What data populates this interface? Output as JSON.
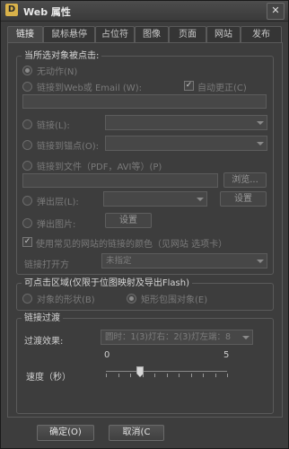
{
  "window": {
    "title": "Web 属性",
    "app_icon": "D",
    "close_glyph": "✕"
  },
  "tabs": [
    {
      "label": "链接",
      "active": true
    },
    {
      "label": "鼠标悬停"
    },
    {
      "label": "占位符"
    },
    {
      "label": "图像"
    },
    {
      "label": "页面"
    },
    {
      "label": "网站"
    },
    {
      "label": "发布"
    }
  ],
  "click_group": {
    "legend": "当所选对象被点击:",
    "no_action": "无动作(N)",
    "link_web_email": "链接到Web或 Email (W):",
    "auto_update": "自动更正(C)",
    "auto_update_checked": true,
    "link": "链接(L):",
    "link_anchor": "链接到锚点(O):",
    "link_file": "链接到文件（PDF，AVI等）(P)",
    "browse_button": "浏览...",
    "popup_layer": "弹出层(L):",
    "popup_layer_settings": "设置",
    "popup_image": "弹出图片:",
    "popup_image_settings": "设置",
    "use_site_colors": "使用常见的网站的链接的颜色（见网站 选项卡）",
    "use_site_colors_checked": true,
    "open_mode_label": "链接打开方",
    "open_mode_value": "未指定"
  },
  "area_group": {
    "legend": "可点击区域(仅限于位图映射及导出Flash)",
    "object_shape": "对象的形状(B)",
    "rect_box": "矩形包围对象(E)"
  },
  "transition_group": {
    "legend": "链接过渡",
    "effect_label": "过渡效果:",
    "effect_value": "圆时：1(3)灯右：2(3)灯左端：8",
    "speed_label": "速度（秒）",
    "speed_min": "0",
    "speed_max": "5",
    "speed_value": 1.4
  },
  "footer": {
    "ok": "确定(O)",
    "cancel": "取消(C"
  },
  "icons": {
    "close": "close-icon",
    "arrow": "chevron-down-icon",
    "app": "app-icon"
  }
}
